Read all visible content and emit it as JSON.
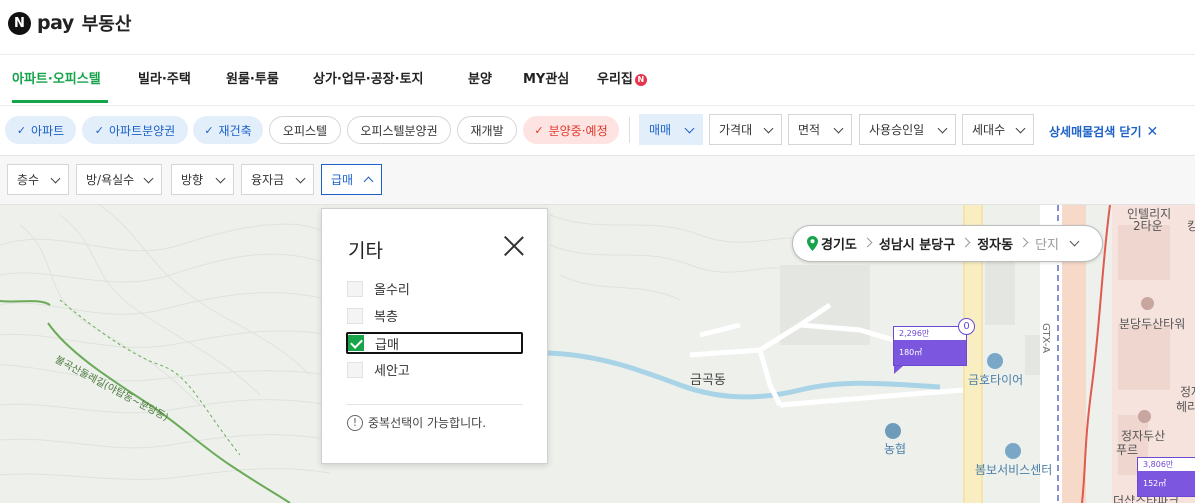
{
  "header": {
    "logo_badge": "N",
    "logo_pay": "pay",
    "service_name": "부동산"
  },
  "nav": {
    "items": [
      "아파트·오피스텔",
      "빌라·주택",
      "원룸·투룸",
      "상가·업무·공장·토지",
      "분양",
      "MY관심",
      "우리집"
    ],
    "active_index": 0,
    "new_badge": "N",
    "active_color": "#17a34a"
  },
  "filters_row1": {
    "chips": [
      {
        "label": "아파트",
        "on": true,
        "check": "✓"
      },
      {
        "label": "아파트분양권",
        "on": true,
        "check": "✓"
      },
      {
        "label": "재건축",
        "on": true,
        "check": "✓"
      },
      {
        "label": "오피스텔",
        "on": false
      },
      {
        "label": "오피스텔분양권",
        "on": false
      },
      {
        "label": "재개발",
        "on": false
      },
      {
        "label": "분양중·예정",
        "on": true,
        "check": "✓"
      }
    ],
    "selects": [
      "매매",
      "가격대",
      "면적",
      "사용승인일",
      "세대수"
    ],
    "detail_link": "상세매물검색 닫기",
    "detail_close": "✕"
  },
  "filters_row2": {
    "selects": [
      "층수",
      "방/욕실수",
      "방향",
      "융자금",
      "급매"
    ],
    "open_index": 4
  },
  "popup": {
    "title": "기타",
    "options": [
      {
        "label": "올수리",
        "checked": false
      },
      {
        "label": "복층",
        "checked": false
      },
      {
        "label": "급매",
        "checked": true
      },
      {
        "label": "세안고",
        "checked": false
      }
    ],
    "note_icon": "!",
    "note": "중복선택이 가능합니다."
  },
  "location": {
    "province": "경기도",
    "city": "성남시 분당구",
    "dong": "정자동",
    "complex": "단지"
  },
  "map": {
    "labels": {
      "geumgok": "금곡동",
      "geumho": "금호타이어",
      "nonghyup": "농협",
      "bombo": "봄보서비스센터",
      "intelli": "인텔리지",
      "twotower": "2타운",
      "bundang_tower": "분당두산타워",
      "gtx": "GTX-A",
      "trail": "불곡산둘레길(야탑동~분당동)",
      "jeongja_a": "정자",
      "jeongja_b": "헤리",
      "jeongja_c": "정자두산",
      "jeongja_d": "푸르",
      "jeongja_e": "더샵스타파크",
      "kyu": "킹"
    },
    "markers": [
      {
        "price": "2,296만",
        "area": "180㎡",
        "count": "0"
      },
      {
        "price": "3,806만",
        "area": "152㎡"
      }
    ]
  }
}
